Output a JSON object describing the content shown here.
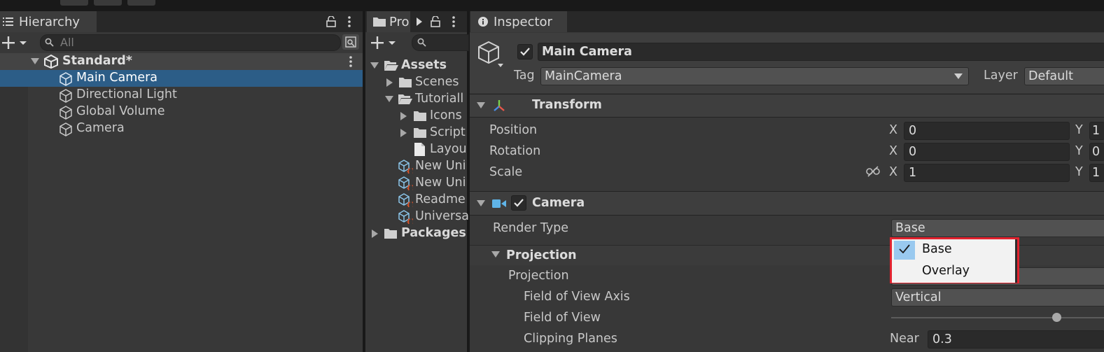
{
  "hierarchy": {
    "tab_label": "Hierarchy",
    "search_placeholder": "All",
    "scene": "Standard*",
    "items": [
      "Main Camera",
      "Directional Light",
      "Global Volume",
      "Camera"
    ]
  },
  "project": {
    "tab_label": "Pro",
    "tree": [
      {
        "label": "Assets"
      },
      {
        "label": "Scenes"
      },
      {
        "label": "Tutoriall"
      },
      {
        "label": "Icons"
      },
      {
        "label": "Script"
      },
      {
        "label": "Layou"
      },
      {
        "label": "New Uni"
      },
      {
        "label": "New Uni"
      },
      {
        "label": "Readme"
      },
      {
        "label": "Universa"
      },
      {
        "label": "Packages"
      }
    ]
  },
  "inspector": {
    "tab_label": "Inspector",
    "object_name": "Main Camera",
    "tag_label": "Tag",
    "tag_value": "MainCamera",
    "layer_label": "Layer",
    "layer_value": "Default",
    "transform": {
      "title": "Transform",
      "rows": [
        {
          "label": "Position",
          "x_label": "X",
          "x": "0",
          "y_label": "Y",
          "y": "1"
        },
        {
          "label": "Rotation",
          "x_label": "X",
          "x": "0",
          "y_label": "Y",
          "y": "0"
        },
        {
          "label": "Scale",
          "x_label": "X",
          "x": "1",
          "y_label": "Y",
          "y": "1"
        }
      ]
    },
    "camera": {
      "title": "Camera",
      "render_type_label": "Render Type",
      "render_type_value": "Base",
      "projection_header": "Projection",
      "projection_label": "Projection",
      "fov_axis_label": "Field of View Axis",
      "fov_axis_value": "Vertical",
      "fov_label": "Field of View",
      "clipping_label": "Clipping Planes",
      "near_label": "Near",
      "near_value": "0.3"
    },
    "dropdown": {
      "options": [
        "Base",
        "Overlay"
      ],
      "selected": "Base",
      "highlight_color": "#e2232f"
    }
  },
  "colors": {
    "selection": "#2c5d87",
    "panel": "#383838",
    "field": "#2a2a2a"
  }
}
